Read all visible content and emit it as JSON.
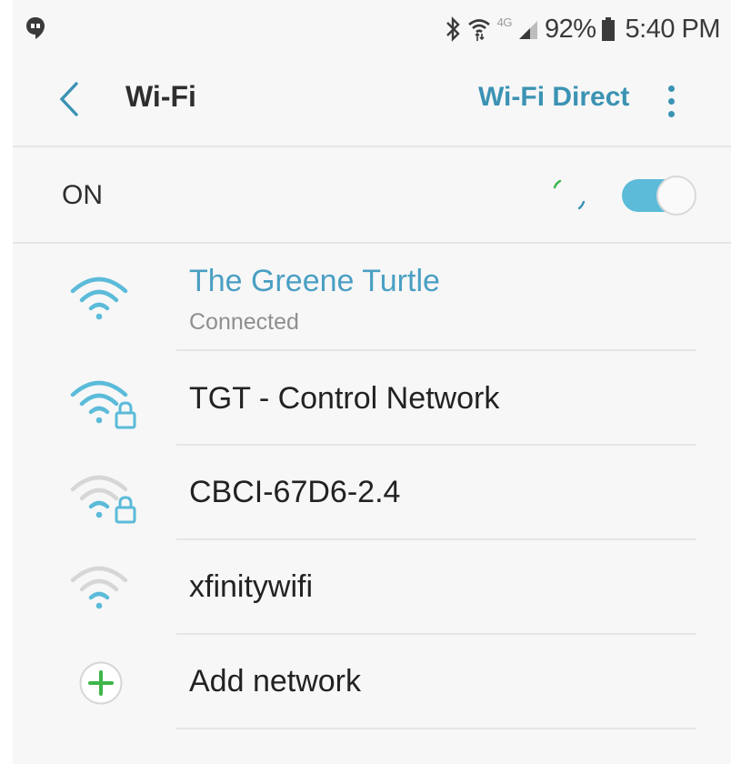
{
  "status_bar": {
    "notification_icon": "hangouts-icon",
    "icons": [
      "bluetooth-icon",
      "wifi-arrows-icon",
      "4g-icon",
      "signal-icon"
    ],
    "network_type": "4G",
    "battery_percent": "92%",
    "battery_icon": "battery-icon",
    "time": "5:40 PM"
  },
  "app_bar": {
    "back_icon": "chevron-left-icon",
    "title": "Wi-Fi",
    "wifi_direct_label": "Wi-Fi Direct",
    "more_icon": "more-vertical-icon"
  },
  "toggle_row": {
    "label": "ON",
    "checked": true
  },
  "networks": [
    {
      "name": "The Greene Turtle",
      "status": "Connected",
      "secured": false,
      "signal_level": 4,
      "icon": "wifi-icon"
    },
    {
      "name": "TGT - Control Network",
      "status": "",
      "secured": true,
      "signal_level": 4,
      "icon": "wifi-lock-icon"
    },
    {
      "name": "CBCI-67D6-2.4",
      "status": "",
      "secured": true,
      "signal_level": 1,
      "icon": "wifi-lock-icon"
    },
    {
      "name": "xfinitywifi",
      "status": "",
      "secured": false,
      "signal_level": 1,
      "icon": "wifi-icon"
    }
  ],
  "add_network": {
    "label": "Add network",
    "icon": "plus-circle-icon"
  },
  "colors": {
    "accent": "#3b93b3",
    "connected": "#4a9fc3",
    "toggle_on": "#5bbbd9",
    "wifi_strong": "#5bbbd9",
    "wifi_weak": "#d6d6d6",
    "add_icon": "#3fb54a",
    "background": "#f7f7f7"
  }
}
